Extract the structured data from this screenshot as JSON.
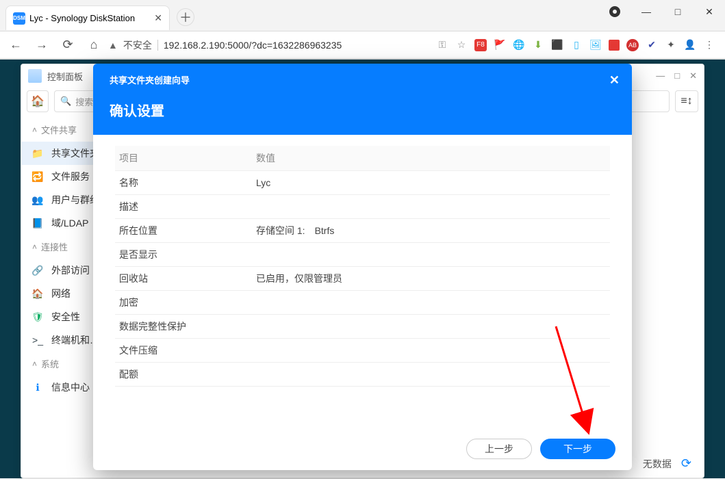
{
  "browser": {
    "tab_title": "Lyc - Synology DiskStation",
    "favicon_text": "DSM",
    "favicon_bg": "#1e88ff",
    "favicon_fg": "#ffffff",
    "insecure_label": "不安全",
    "url": "192.168.2.190:5000/?dc=1632286963235"
  },
  "dsm_window": {
    "title": "控制面板",
    "search_placeholder": "搜索",
    "footer_text": "无数据"
  },
  "sidebar": {
    "sections": [
      {
        "label": "文件共享",
        "items": [
          {
            "label": "共享文件夹",
            "icon_bg": "#f7a440",
            "glyph": "📁",
            "active": true
          },
          {
            "label": "文件服务",
            "icon_bg": "#0a84ff",
            "glyph": "🔁",
            "active": false
          },
          {
            "label": "用户与群组",
            "icon_bg": "#1e88ff",
            "glyph": "👥",
            "active": false
          },
          {
            "label": "域/LDAP",
            "icon_bg": "#1e88ff",
            "glyph": "📘",
            "active": false
          }
        ]
      },
      {
        "label": "连接性",
        "items": [
          {
            "label": "外部访问",
            "icon_bg": "#0a84ff",
            "glyph": "🔗",
            "active": false
          },
          {
            "label": "网络",
            "icon_bg": "#ff7043",
            "glyph": "🏠",
            "active": false
          },
          {
            "label": "安全性",
            "icon_bg": "#17b26a",
            "glyph": "🛡",
            "active": false
          },
          {
            "label": "终端机和…",
            "icon_bg": "#37474f",
            "glyph": ">_",
            "active": false
          }
        ]
      },
      {
        "label": "系统",
        "items": [
          {
            "label": "信息中心",
            "icon_bg": "#0a84ff",
            "glyph": "ℹ",
            "active": false
          }
        ]
      }
    ]
  },
  "modal": {
    "wizard_title": "共享文件夹创建向导",
    "step_title": "确认设置",
    "columns": {
      "key": "项目",
      "value": "数值"
    },
    "rows": [
      {
        "k": "名称",
        "v": "Lyc"
      },
      {
        "k": "描述",
        "v": ""
      },
      {
        "k": "所在位置",
        "v": "存储空间 1: Btrfs"
      },
      {
        "k": "是否显示",
        "v": ""
      },
      {
        "k": "回收站",
        "v": "已启用，仅限管理员"
      },
      {
        "k": "加密",
        "v": ""
      },
      {
        "k": "数据完整性保护",
        "v": ""
      },
      {
        "k": "文件压缩",
        "v": ""
      },
      {
        "k": "配额",
        "v": ""
      }
    ],
    "buttons": {
      "prev": "上一步",
      "next": "下一步"
    }
  }
}
